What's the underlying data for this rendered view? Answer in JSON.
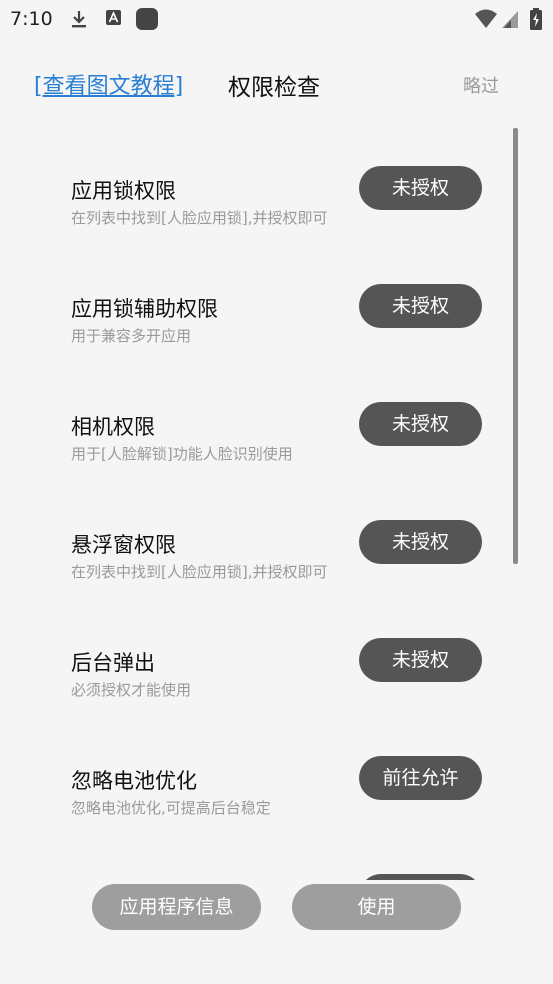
{
  "status_bar": {
    "time": "7:10",
    "icons": [
      "download-icon",
      "font-icon",
      "app-square-icon",
      "wifi-icon",
      "signal-icon",
      "battery-charging-icon"
    ]
  },
  "header": {
    "tutorial_link": "[查看图文教程]",
    "title": "权限检查",
    "skip": "略过"
  },
  "permissions": [
    {
      "title": "应用锁权限",
      "desc": "在列表中找到[人脸应用锁],并授权即可",
      "button": "未授权"
    },
    {
      "title": "应用锁辅助权限",
      "desc": "用于兼容多开应用",
      "button": "未授权"
    },
    {
      "title": "相机权限",
      "desc": "用于[人脸解锁]功能人脸识别使用",
      "button": "未授权"
    },
    {
      "title": "悬浮窗权限",
      "desc": "在列表中找到[人脸应用锁],并授权即可",
      "button": "未授权"
    },
    {
      "title": "后台弹出",
      "desc": "必须授权才能使用",
      "button": "未授权"
    },
    {
      "title": "忽略电池优化",
      "desc": "忽略电池优化,可提高后台稳定",
      "button": "前往允许"
    }
  ],
  "bottom": {
    "app_info": "应用程序信息",
    "use": "使用"
  },
  "colors": {
    "tutorial_link": "#2a7fd4",
    "item_button": "#555555",
    "bottom_button": "#9e9e9e",
    "background": "#f5f5f5"
  }
}
